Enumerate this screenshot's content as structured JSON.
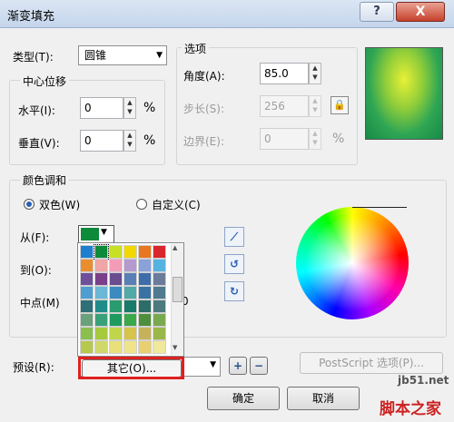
{
  "window": {
    "title": "渐变填充",
    "help": "?",
    "close": "X"
  },
  "type_row": {
    "label": "类型(T):",
    "value": "圆锥"
  },
  "center": {
    "group_title": "中心位移",
    "horizontal_label": "水平(I):",
    "horizontal_value": "0",
    "horizontal_unit": "%",
    "vertical_label": "垂直(V):",
    "vertical_value": "0",
    "vertical_unit": "%"
  },
  "options": {
    "group_title": "选项",
    "angle_label": "角度(A):",
    "angle_value": "85.0",
    "steps_label": "步长(S):",
    "steps_value": "256",
    "edge_label": "边界(E):",
    "edge_value": "0",
    "edge_unit": "%"
  },
  "blend": {
    "group_title": "颜色调和",
    "two_color_label": "双色(W)",
    "custom_label": "自定义(C)",
    "from_label": "从(F):",
    "to_label": "到(O):",
    "mid_label": "中点(M)",
    "mid_value_partial": "0"
  },
  "palette": {
    "colors": [
      [
        "#1e7fcf",
        "#0d8a3a",
        "#c8e024",
        "#f2d800",
        "#e87722",
        "#d8262c",
        "#c2307d",
        "#703c98"
      ],
      [
        "#e98d2e",
        "#f0a5a6",
        "#f39cb7",
        "#b59ad0",
        "#8aa2da",
        "#55b3e0",
        "#a98fc7",
        "#7aa0c8"
      ],
      [
        "#6f4f9c",
        "#7b3f8a",
        "#6b4c8f",
        "#5a7fb6",
        "#3f6da9",
        "#6a7c9a",
        "#8f6fae",
        "#a14f6f"
      ],
      [
        "#4f9ed1",
        "#6ab7d6",
        "#3b8bbf",
        "#51a9a8",
        "#3a73a3",
        "#507a8f",
        "#35425e",
        "#2b5d8a"
      ],
      [
        "#2f6f77",
        "#1f8c8a",
        "#2a9a6f",
        "#1a7b6a",
        "#2c6d6a",
        "#4d7a7f",
        "#3a5f73",
        "#3f6b5a"
      ],
      [
        "#6aa07a",
        "#39a07a",
        "#1f9a5f",
        "#3ba94a",
        "#4e8f3c",
        "#79a94f",
        "#8a9f5f",
        "#6f8f4a"
      ],
      [
        "#8bbf4e",
        "#a7c93c",
        "#c0d64a",
        "#d7c44a",
        "#c6b25a",
        "#9ab84a",
        "#7ab84a",
        "#88c060"
      ],
      [
        "#b6c84e",
        "#d0d86a",
        "#e8e07a",
        "#f0e48a",
        "#e8d070",
        "#f0e89a",
        "#f2ee9e",
        "#e0e68a"
      ]
    ],
    "other_button_label": "其它(O)..."
  },
  "preset": {
    "label": "预设(R):"
  },
  "postscript_button": "PostScript 选项(P)...",
  "footer": {
    "ok": "确定",
    "cancel": "取消"
  },
  "watermark": {
    "line1": "jb51.net",
    "line2": "脚本之家"
  }
}
